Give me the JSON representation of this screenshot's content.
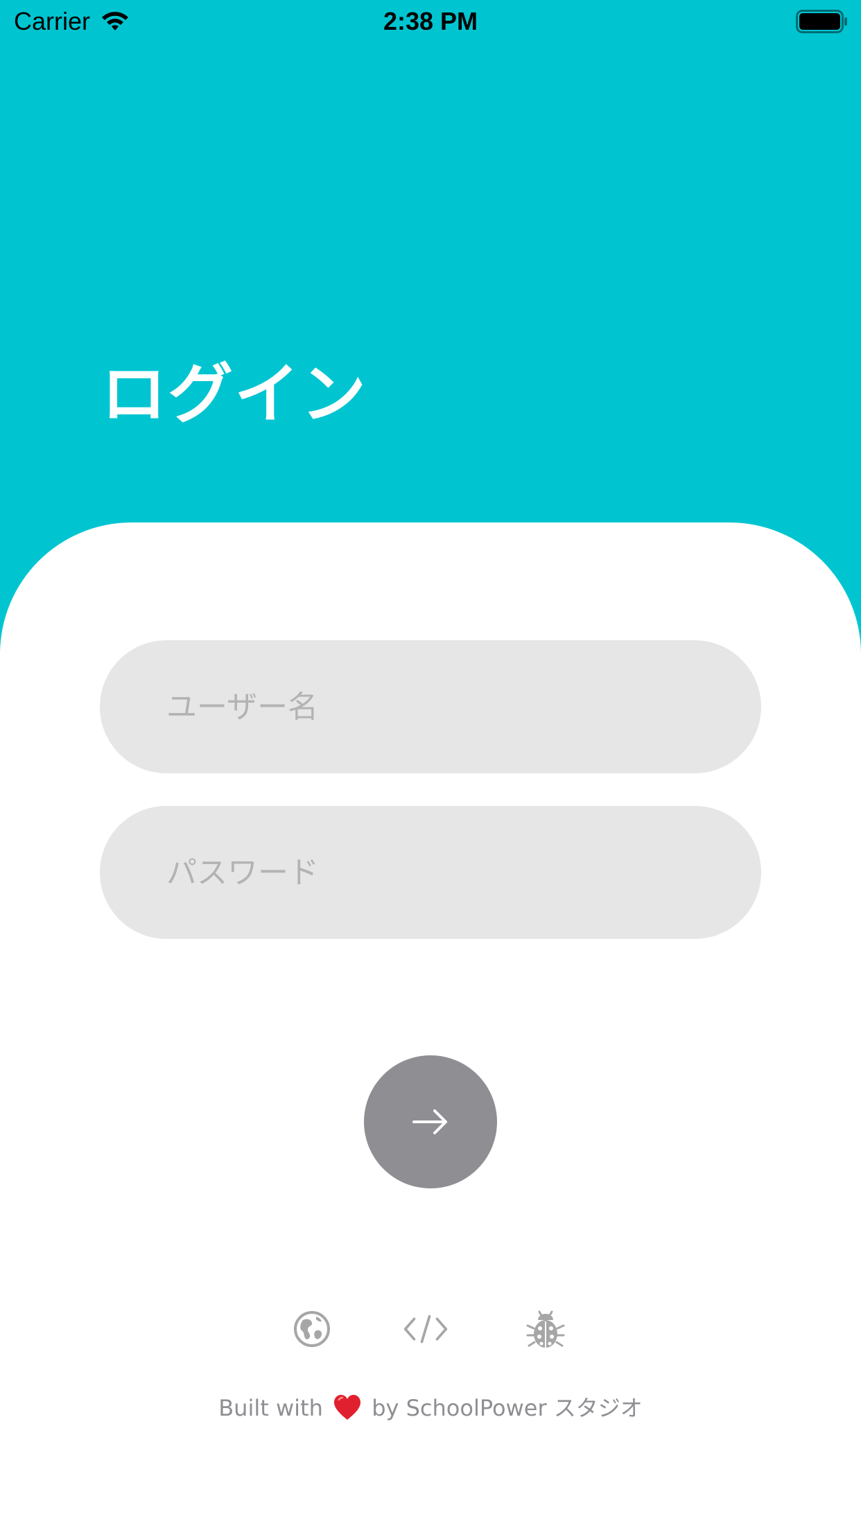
{
  "status_bar": {
    "carrier": "Carrier",
    "time": "2:38 PM"
  },
  "header": {
    "title": "ログイン",
    "background_color": "#00c5d1"
  },
  "form": {
    "username_placeholder": "ユーザー名",
    "username_value": "",
    "password_placeholder": "パスワード",
    "password_value": "",
    "submit_icon": "arrow-right-icon",
    "submit_color": "#8e8e93"
  },
  "links": [
    {
      "icon": "globe-icon"
    },
    {
      "icon": "code-icon"
    },
    {
      "icon": "bug-icon"
    }
  ],
  "footer": {
    "built_with": "Built with",
    "heart_icon": "heart-icon",
    "by_text": "by SchoolPower スタジオ"
  }
}
